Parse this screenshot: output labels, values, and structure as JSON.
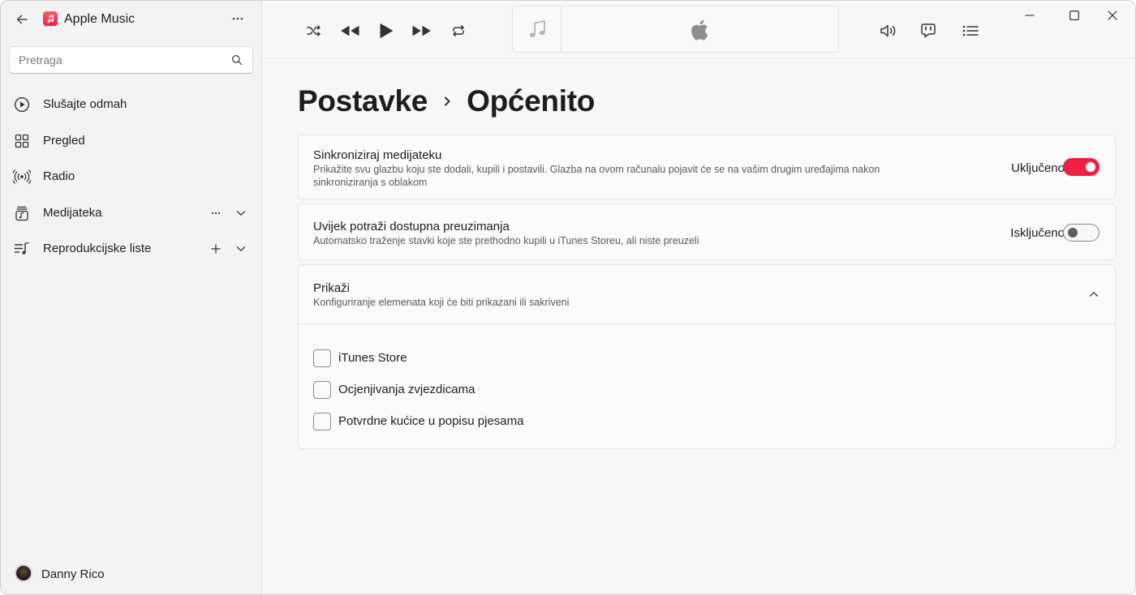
{
  "app": {
    "title": "Apple Music",
    "accent": "#f21f45"
  },
  "sidebar": {
    "search": {
      "placeholder": "Pretraga",
      "value": ""
    },
    "items": [
      {
        "label": "Slušajte odmah",
        "icon": "play-circle-icon"
      },
      {
        "label": "Pregled",
        "icon": "grid-icon"
      },
      {
        "label": "Radio",
        "icon": "radio-waves-icon"
      },
      {
        "label": "Medijateka",
        "icon": "library-icon"
      },
      {
        "label": "Reprodukcijske liste",
        "icon": "playlist-icon"
      }
    ],
    "profile": {
      "name": "Danny Rico"
    }
  },
  "topbar": {
    "controls": [
      "shuffle-icon",
      "previous-icon",
      "play-icon",
      "next-icon",
      "repeat-icon"
    ],
    "right": [
      "volume-icon",
      "lyrics-icon",
      "queue-icon"
    ],
    "window_controls": [
      "minimize-icon",
      "maximize-icon",
      "close-icon"
    ]
  },
  "main": {
    "breadcrumb": [
      "Postavke",
      "Općenito"
    ],
    "sync": {
      "title": "Sinkroniziraj medijateku",
      "desc": "Prikažite svu glazbu koju ste dodali, kupili i postavili. Glazba na ovom računalu pojavit će se na vašim drugim uređajima nakon sinkroniziranja s oblakom",
      "state": "Uključeno",
      "on": true
    },
    "downloads": {
      "title": "Uvijek potraži dostupna preuzimanja",
      "desc": "Automatsko traženje stavki koje ste prethodno kupili u iTunes Storeu, ali niste preuzeli",
      "state": "Isključeno",
      "on": false
    },
    "show": {
      "title": "Prikaži",
      "desc": "Konfiguriranje elemenata koji će biti prikazani ili sakriveni",
      "options": [
        {
          "label": "iTunes Store",
          "checked": false
        },
        {
          "label": "Ocjenjivanja zvjezdicama",
          "checked": false
        },
        {
          "label": "Potvrdne kućice u popisu pjesama",
          "checked": false
        }
      ]
    }
  }
}
